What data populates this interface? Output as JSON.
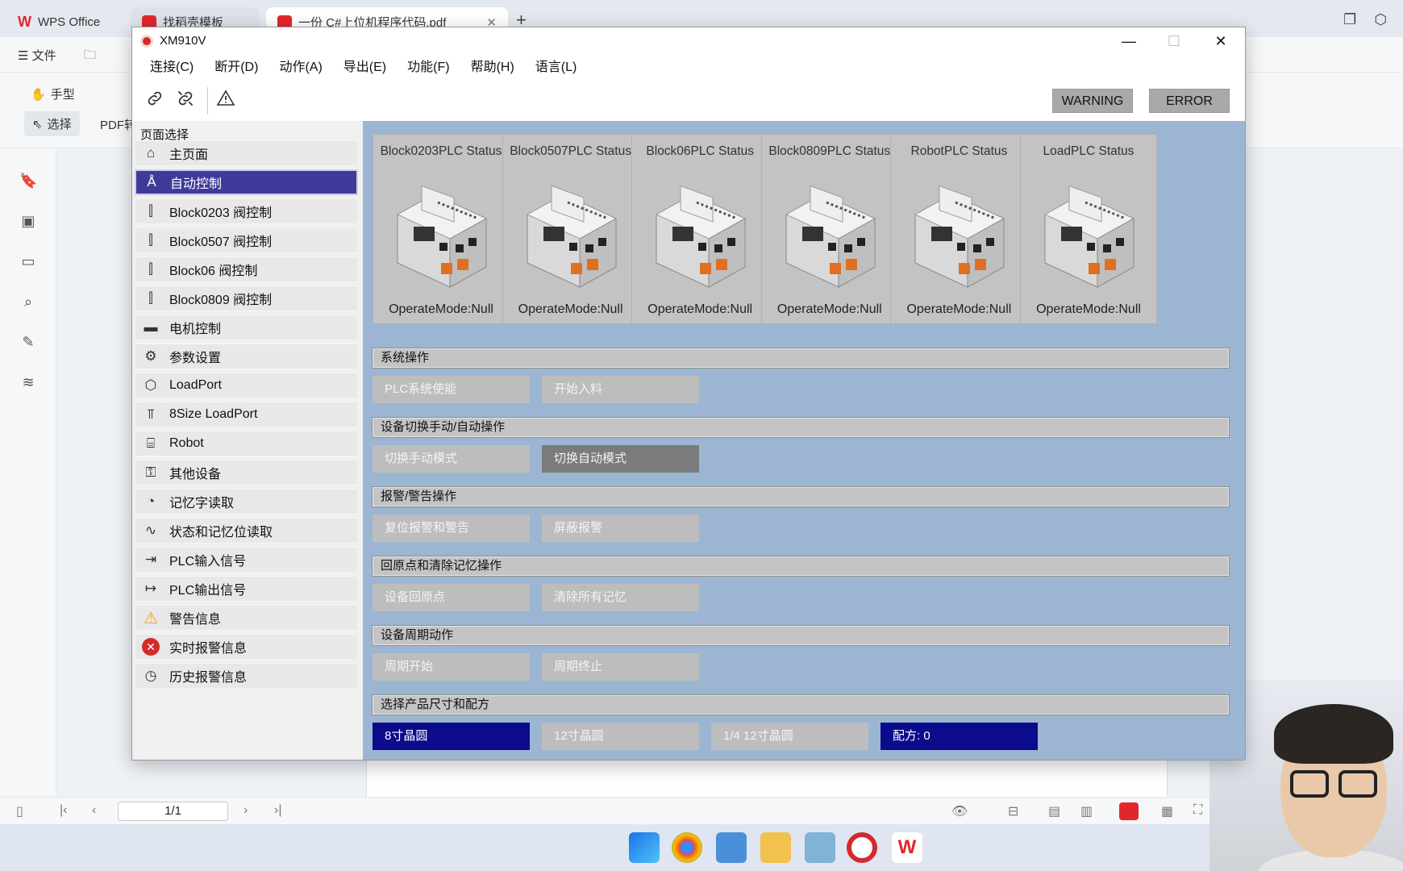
{
  "wps": {
    "tabs": [
      {
        "label": "WPS Office"
      },
      {
        "label": "找稻壳模板"
      },
      {
        "label": "一份 C#上位机程序代码.pdf"
      }
    ],
    "menu_file": "文件",
    "tool_hand": "手型",
    "tool_select": "选择",
    "tool_pdf": "PDF转",
    "page_indicator": "1/1"
  },
  "app": {
    "title": "XM910V",
    "menu": [
      {
        "label": "连接(C)"
      },
      {
        "label": "断开(D)"
      },
      {
        "label": "动作(A)"
      },
      {
        "label": "导出(E)"
      },
      {
        "label": "功能(F)"
      },
      {
        "label": "帮助(H)"
      },
      {
        "label": "语言(L)"
      }
    ],
    "status_buttons": {
      "warning": "WARNING",
      "error": "ERROR"
    },
    "sidebar": {
      "title": "页面选择",
      "active_index": 1,
      "items": [
        {
          "label": "主页面",
          "icon": "home-icon"
        },
        {
          "label": "自动控制",
          "icon": "auto-control-icon"
        },
        {
          "label": "Block0203 阀控制",
          "icon": "valve-icon"
        },
        {
          "label": "Block0507 阀控制",
          "icon": "valve-icon"
        },
        {
          "label": "Block06 阀控制",
          "icon": "valve-icon"
        },
        {
          "label": "Block0809 阀控制",
          "icon": "valve-icon"
        },
        {
          "label": "电机控制",
          "icon": "motor-icon"
        },
        {
          "label": "参数设置",
          "icon": "gears-icon"
        },
        {
          "label": "LoadPort",
          "icon": "cube-icon"
        },
        {
          "label": "8Size LoadPort",
          "icon": "loadport-icon"
        },
        {
          "label": "Robot",
          "icon": "robot-icon"
        },
        {
          "label": "其他设备",
          "icon": "device-icon"
        },
        {
          "label": "记忆字读取",
          "icon": "memory-icon"
        },
        {
          "label": "状态和记忆位读取",
          "icon": "waveform-icon"
        },
        {
          "label": "PLC输入信号",
          "icon": "signal-in-icon"
        },
        {
          "label": "PLC输出信号",
          "icon": "signal-out-icon"
        },
        {
          "label": "警告信息",
          "icon": "warning-icon"
        },
        {
          "label": "实时报警信息",
          "icon": "error-icon"
        },
        {
          "label": "历史报警信息",
          "icon": "history-icon"
        }
      ]
    },
    "plc_cards": [
      {
        "title": "Block0203PLC Status",
        "mode": "OperateMode:Null"
      },
      {
        "title": "Block0507PLC Status",
        "mode": "OperateMode:Null"
      },
      {
        "title": "Block06PLC Status",
        "mode": "OperateMode:Null"
      },
      {
        "title": "Block0809PLC Status",
        "mode": "OperateMode:Null"
      },
      {
        "title": "RobotPLC Status",
        "mode": "OperateMode:Null"
      },
      {
        "title": "LoadPLC Status",
        "mode": "OperateMode:Null"
      }
    ],
    "sections": [
      {
        "title": "系统操作",
        "buttons": [
          {
            "label": "PLC系统使能",
            "style": "normal"
          },
          {
            "label": "开始入料",
            "style": "normal"
          }
        ]
      },
      {
        "title": "设备切换手动/自动操作",
        "buttons": [
          {
            "label": "切换手动模式",
            "style": "normal"
          },
          {
            "label": "切换自动模式",
            "style": "dark"
          }
        ]
      },
      {
        "title": "报警/警告操作",
        "buttons": [
          {
            "label": "复位报警和警告",
            "style": "normal"
          },
          {
            "label": "屏蔽报警",
            "style": "normal"
          }
        ]
      },
      {
        "title": "回原点和清除记忆操作",
        "buttons": [
          {
            "label": "设备回原点",
            "style": "normal"
          },
          {
            "label": "清除所有记忆",
            "style": "normal"
          }
        ]
      },
      {
        "title": "设备周期动作",
        "buttons": [
          {
            "label": "周期开始",
            "style": "normal"
          },
          {
            "label": "周期终止",
            "style": "normal"
          }
        ]
      },
      {
        "title": "选择产品尺寸和配方",
        "buttons": [
          {
            "label": "8寸晶圆",
            "style": "blue"
          },
          {
            "label": "12寸晶圆",
            "style": "normal"
          },
          {
            "label": "1/4 12寸晶圆",
            "style": "normal"
          },
          {
            "label": "配方: 0",
            "style": "blue"
          }
        ]
      }
    ]
  },
  "colors": {
    "main_bg": "#9bb5d3",
    "active_nav": "#3f3a9a",
    "selected_button": "#0b0b8c",
    "dark_button": "#7b7b7b",
    "wps_red": "#e2262b"
  }
}
